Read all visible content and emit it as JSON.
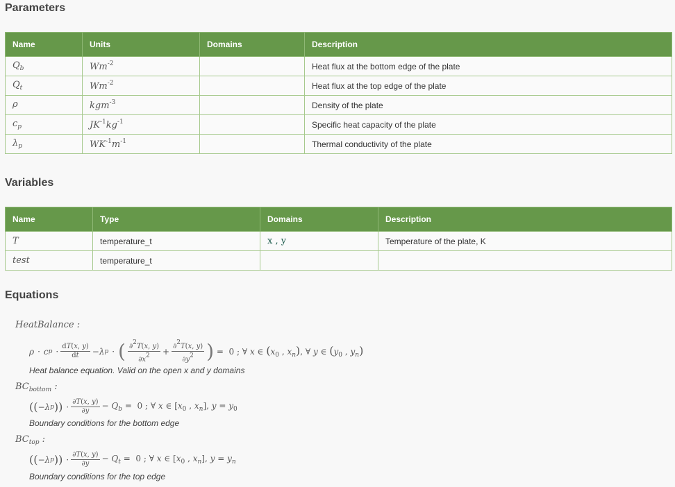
{
  "parameters": {
    "heading": "Parameters",
    "headers": [
      "Name",
      "Units",
      "Domains",
      "Description"
    ],
    "rows": [
      {
        "name": "Q",
        "sub": "b",
        "units_html": "Wm<sup>-2</sup>",
        "domains": "",
        "description": "Heat flux at the bottom edge of the plate"
      },
      {
        "name": "Q",
        "sub": "t",
        "units_html": "Wm<sup>-2</sup>",
        "domains": "",
        "description": "Heat flux at the top edge of the plate"
      },
      {
        "name": "ρ",
        "sub": "",
        "units_html": "kgm<sup>-3</sup>",
        "domains": "",
        "description": "Density of the plate"
      },
      {
        "name": "c",
        "sub": "p",
        "units_html": "JK<sup>-1</sup>kg<sup>-1</sup>",
        "domains": "",
        "description": "Specific heat capacity of the plate"
      },
      {
        "name": "λ",
        "sub": "p",
        "units_html": "WK<sup>-1</sup>m<sup>-1</sup>",
        "domains": "",
        "description": "Thermal conductivity of the plate"
      }
    ]
  },
  "variables": {
    "heading": "Variables",
    "headers": [
      "Name",
      "Type",
      "Domains",
      "Description"
    ],
    "rows": [
      {
        "name": "T",
        "type": "temperature_t",
        "domains": "x , y",
        "description": "Temperature of the plate, K"
      },
      {
        "name": "test",
        "type": "temperature_t",
        "domains": "",
        "description": ""
      }
    ]
  },
  "equations": {
    "heading": "Equations",
    "items": [
      {
        "name": "HeatBalance",
        "sub": "",
        "description": "Heat balance equation. Valid on the open x and y domains"
      },
      {
        "name": "BC",
        "sub": "bottom",
        "description": "Boundary conditions for the bottom edge"
      },
      {
        "name": "BC",
        "sub": "top",
        "description": "Boundary conditions for the top edge"
      }
    ]
  }
}
